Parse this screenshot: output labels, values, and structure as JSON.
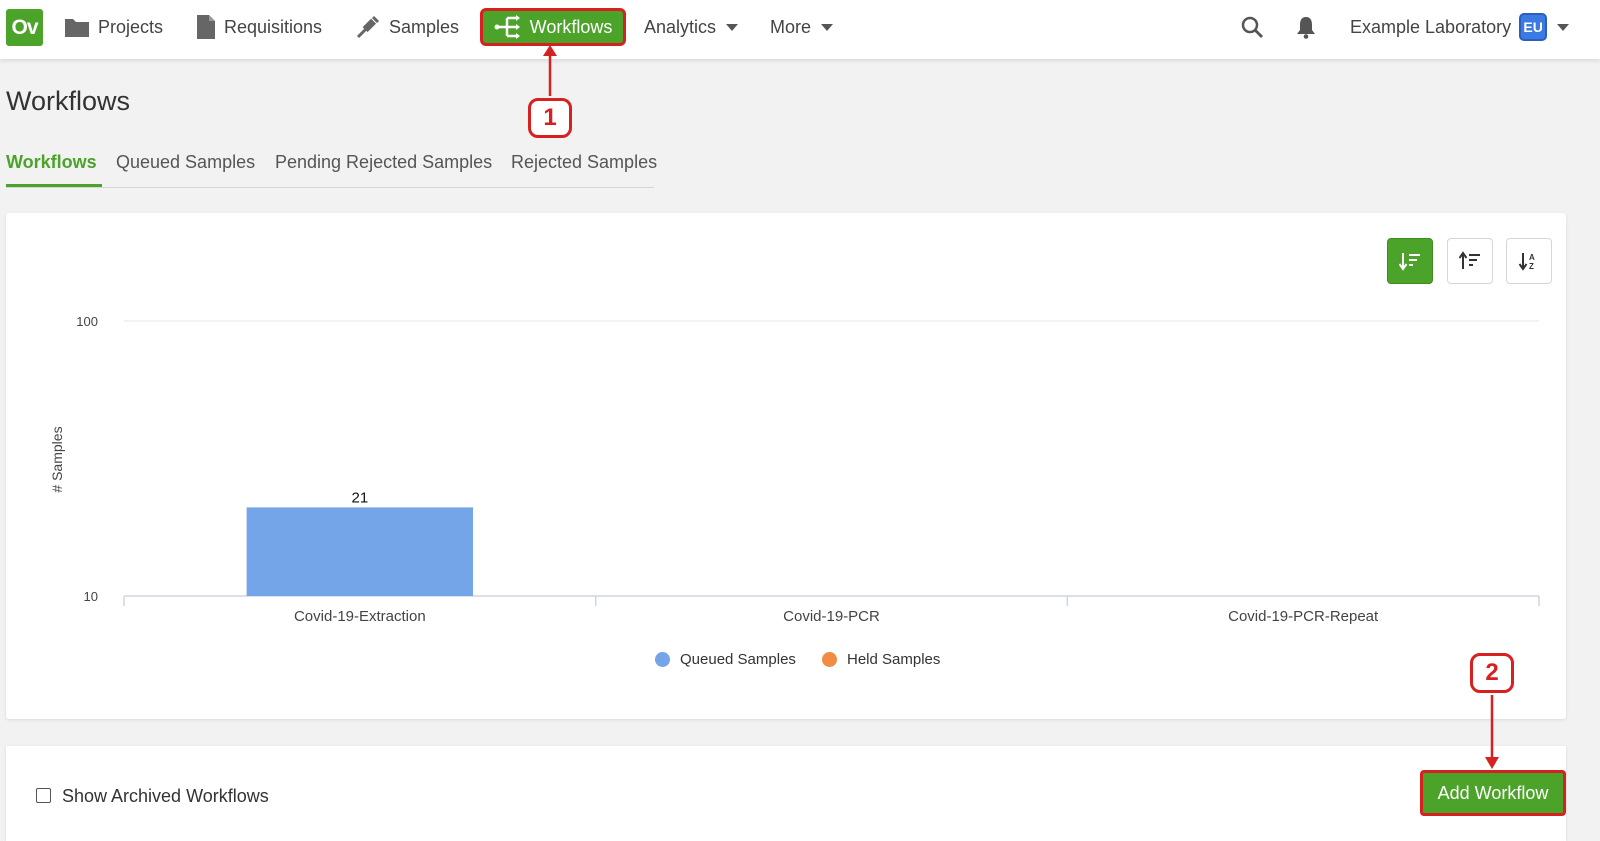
{
  "nav": {
    "logo": "Ov",
    "items": [
      {
        "label": "Projects",
        "icon": "folder-icon"
      },
      {
        "label": "Requisitions",
        "icon": "document-icon"
      },
      {
        "label": "Samples",
        "icon": "pipette-icon"
      }
    ],
    "active": {
      "label": "Workflows",
      "icon": "workflow-icon"
    },
    "dropdowns": [
      {
        "label": "Analytics"
      },
      {
        "label": "More"
      }
    ],
    "lab_name": "Example Laboratory",
    "avatar": "EU"
  },
  "annotations": {
    "one": "1",
    "two": "2",
    "color": "#d92020"
  },
  "page": {
    "title": "Workflows",
    "tabs": [
      "Workflows",
      "Queued Samples",
      "Pending Rejected Samples",
      "Rejected Samples"
    ],
    "active_tab": "Workflows"
  },
  "sort_buttons": [
    "sort-descending-icon",
    "sort-ascending-icon",
    "sort-alpha-icon"
  ],
  "chart_data": {
    "type": "bar",
    "scale": "log",
    "categories": [
      "Covid-19-Extraction",
      "Covid-19-PCR",
      "Covid-19-PCR-Repeat"
    ],
    "series": [
      {
        "name": "Queued Samples",
        "values": [
          21,
          null,
          null
        ],
        "color": "#73a5e8"
      },
      {
        "name": "Held Samples",
        "values": [
          null,
          null,
          null
        ],
        "color": "#f08c43"
      }
    ],
    "ylabel": "# Samples",
    "yticks": [
      10,
      100
    ],
    "ylim": [
      10,
      100
    ],
    "data_labels": [
      "21"
    ],
    "legend_position": "bottom-center",
    "grid": true
  },
  "footer": {
    "checkbox_label": "Show Archived Workflows",
    "add_button": "Add Workflow"
  },
  "colors": {
    "accent": "#4ca32a"
  }
}
